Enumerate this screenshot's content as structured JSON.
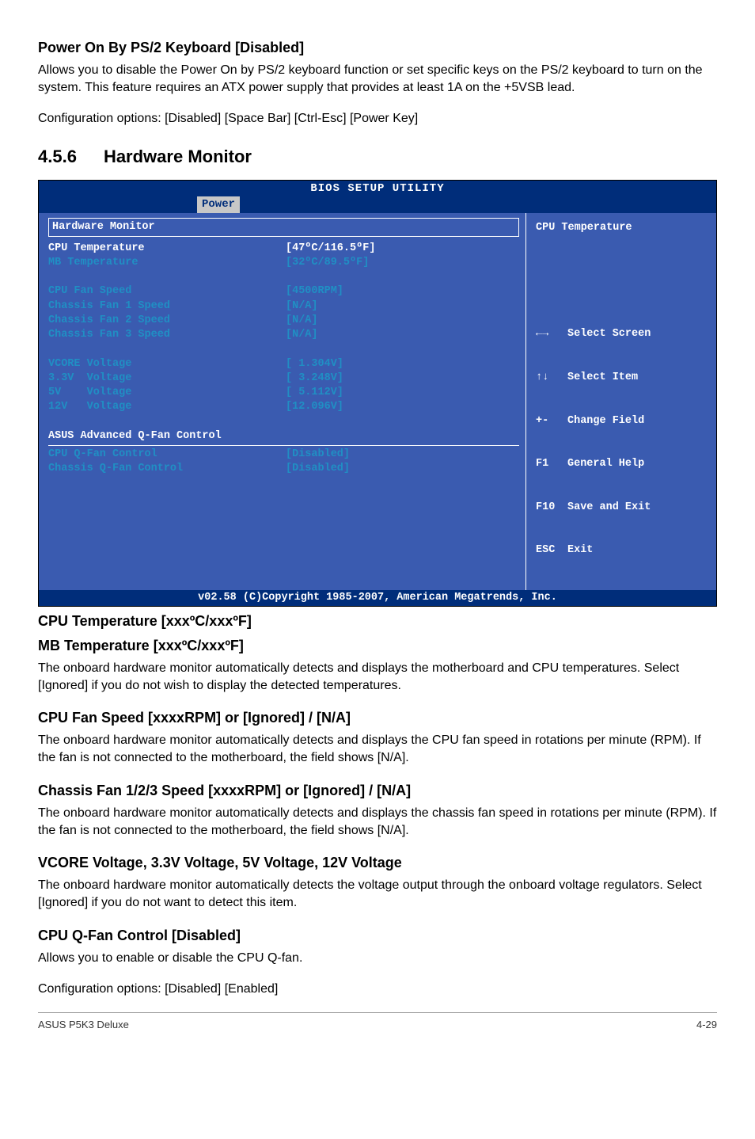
{
  "sec1": {
    "title": "Power On By PS/2 Keyboard [Disabled]",
    "p1": "Allows you to disable the Power On by PS/2 keyboard function or set specific keys on the PS/2 keyboard to turn on the system. This feature requires an ATX power supply that provides at least 1A on the +5VSB lead.",
    "p2": "Configuration options: [Disabled] [Space Bar] [Ctrl-Esc] [Power Key]"
  },
  "sec_num": "4.5.6",
  "sec_title": "Hardware Monitor",
  "bios": {
    "top": "BIOS SETUP UTILITY",
    "tab": "Power",
    "panel_title": "Hardware Monitor",
    "rows": {
      "r1_l": "CPU Temperature",
      "r1_v": "[47ºC/116.5ºF]",
      "r2_l": "MB Temperature",
      "r2_v": "[32ºC/89.5ºF]",
      "r3_l": "CPU Fan Speed",
      "r3_v": "[4500RPM]",
      "r4_l": "Chassis Fan 1 Speed",
      "r4_v": "[N/A]",
      "r5_l": "Chassis Fan 2 Speed",
      "r5_v": "[N/A]",
      "r6_l": "Chassis Fan 3 Speed",
      "r6_v": "[N/A]",
      "r7_l": "VCORE Voltage",
      "r7_v": "[ 1.304V]",
      "r8_l": "3.3V  Voltage",
      "r8_v": "[ 3.248V]",
      "r9_l": "5V    Voltage",
      "r9_v": "[ 5.112V]",
      "r10_l": "12V   Voltage",
      "r10_v": "[12.096V]",
      "r11_l": "ASUS Advanced Q-Fan Control",
      "r11_v": "",
      "r12_l": "CPU Q-Fan Control",
      "r12_v": "[Disabled]",
      "r13_l": "Chassis Q-Fan Control",
      "r13_v": "[Disabled]"
    },
    "help_title": "CPU Temperature",
    "legend": {
      "l1": "Select Screen",
      "l2": "Select Item",
      "l3_k": "+-",
      "l3": "Change Field",
      "l4_k": "F1",
      "l4": "General Help",
      "l5_k": "F10",
      "l5": "Save and Exit",
      "l6_k": "ESC",
      "l6": "Exit"
    },
    "footer": "v02.58 (C)Copyright 1985-2007, American Megatrends, Inc."
  },
  "sec2": {
    "title1": "CPU Temperature [xxxºC/xxxºF]",
    "title2": "MB Temperature [xxxºC/xxxºF]",
    "p": "The onboard hardware monitor automatically detects and displays the motherboard and CPU temperatures. Select [Ignored] if you do not wish to display the detected temperatures."
  },
  "sec3": {
    "title": "CPU Fan Speed [xxxxRPM] or [Ignored] / [N/A]",
    "p": "The onboard hardware monitor automatically detects and displays the CPU fan speed in rotations per minute (RPM). If the fan is not connected to the motherboard, the field shows [N/A]."
  },
  "sec4": {
    "title": "Chassis Fan 1/2/3 Speed [xxxxRPM] or [Ignored] / [N/A]",
    "p": "The onboard hardware monitor automatically detects and displays the chassis fan speed in rotations per minute (RPM). If the fan is not connected to the motherboard, the field shows [N/A]."
  },
  "sec5": {
    "title": "VCORE Voltage, 3.3V Voltage, 5V Voltage, 12V Voltage",
    "p": "The onboard hardware monitor automatically detects the voltage output through the onboard voltage regulators. Select [Ignored] if you do not want to detect this item."
  },
  "sec6": {
    "title": "CPU Q-Fan Control [Disabled]",
    "p1": "Allows you to enable or disable the CPU Q-fan.",
    "p2": "Configuration options: [Disabled] [Enabled]"
  },
  "footer": {
    "left": "ASUS P5K3 Deluxe",
    "right": "4-29"
  }
}
